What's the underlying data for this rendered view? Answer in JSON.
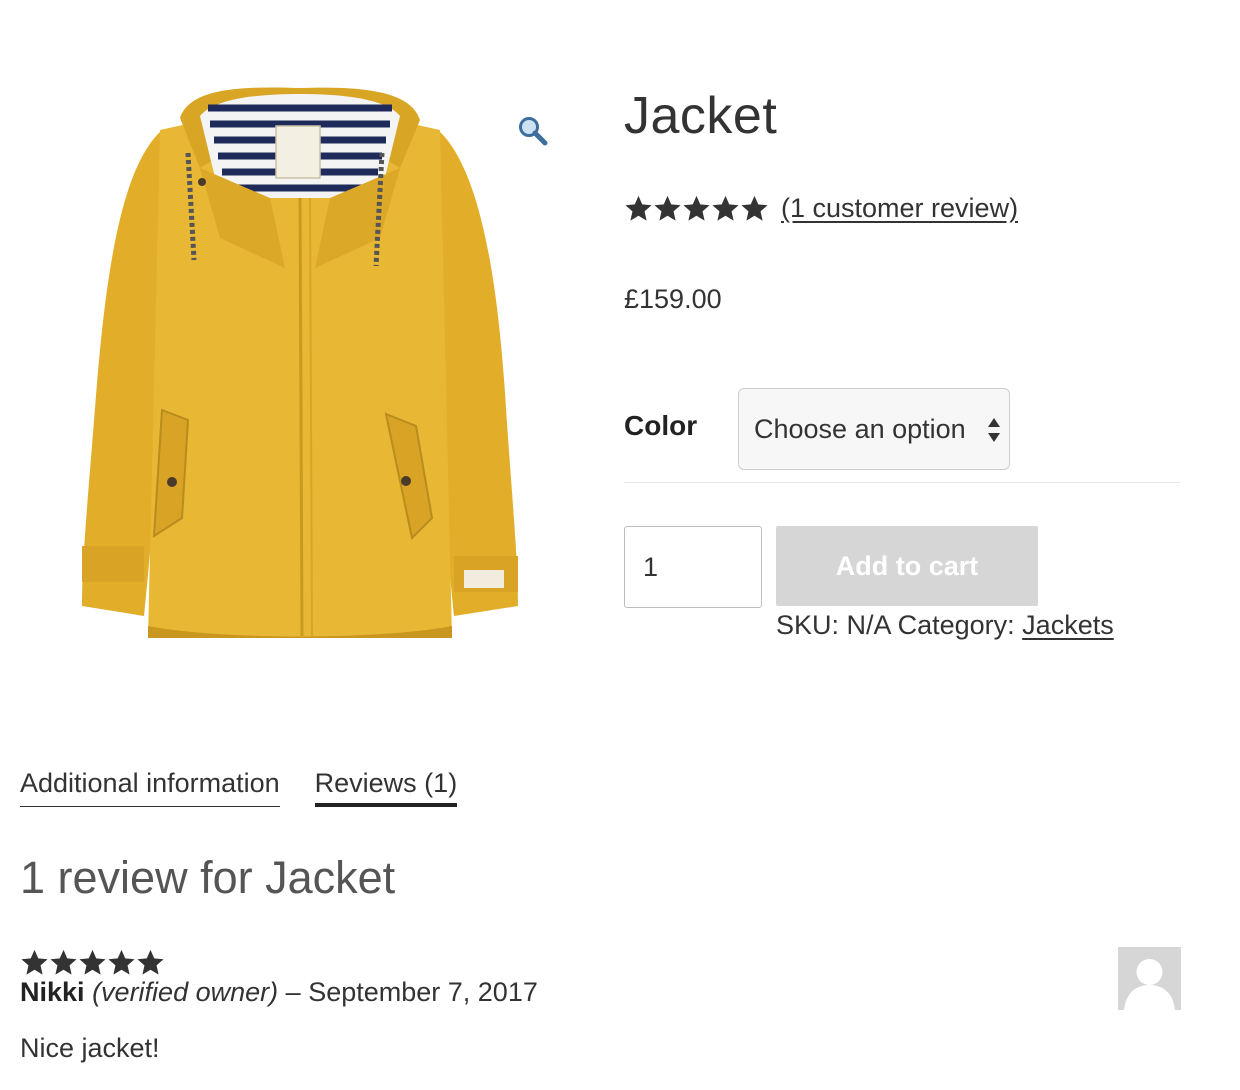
{
  "product": {
    "title": "Jacket",
    "rating": 5,
    "rating_max": 5,
    "review_link": "(1 customer review)",
    "price": "£159.00",
    "image_icon": "yellow-jacket-image"
  },
  "variation": {
    "label": "Color",
    "selected": "Choose an option"
  },
  "cart": {
    "quantity": "1",
    "add_to_cart_label": "Add to cart"
  },
  "meta": {
    "sku_label": "SKU:",
    "sku_value": "N/A",
    "category_label": "Category:",
    "category_value": "Jackets"
  },
  "tabs": [
    {
      "label": "Additional information",
      "active": false
    },
    {
      "label": "Reviews (1)",
      "active": true
    }
  ],
  "reviews": {
    "title": "1 review for Jacket",
    "items": [
      {
        "rating": 5,
        "author": "Nikki",
        "verified": "(verified owner)",
        "separator": "–",
        "date": "September 7, 2017",
        "text": "Nice jacket!"
      }
    ]
  },
  "colors": {
    "text": "#333333",
    "button_disabled": "#d6d6d6",
    "jacket": "#e5b32e",
    "stripe": "#1e2a5a"
  }
}
